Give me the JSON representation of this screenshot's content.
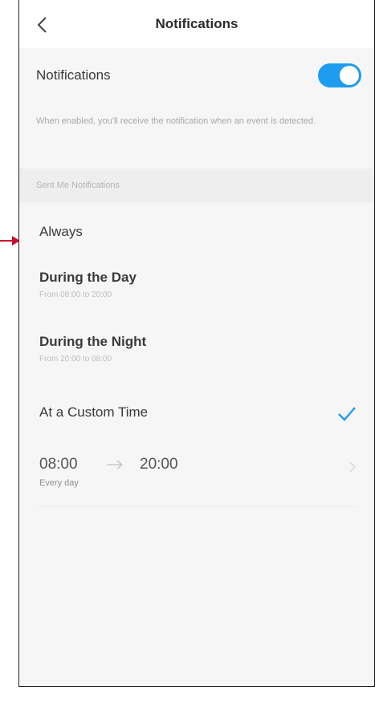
{
  "header": {
    "title": "Notifications",
    "back_icon": "chevron-left-icon"
  },
  "notifications": {
    "label": "Notifications",
    "enabled": true,
    "toggle_color": "#1e9cef",
    "description": "When enabled, you'll receive the notification when an event is detected."
  },
  "section": {
    "title": "Sent Me Notifications"
  },
  "options": [
    {
      "title": "Always",
      "subtitle": "",
      "selected": false
    },
    {
      "title": "During the Day",
      "subtitle": "From 08:00 to 20:00",
      "selected": false
    },
    {
      "title": "During the Night",
      "subtitle": "From 20:00 to 08:00",
      "selected": false
    },
    {
      "title": "At a Custom Time",
      "subtitle": "",
      "selected": true
    }
  ],
  "custom_time": {
    "start": "08:00",
    "end": "20:00",
    "repeat": "Every day"
  },
  "colors": {
    "accent": "#1e9cef",
    "annotation_arrow": "#c8102e"
  }
}
